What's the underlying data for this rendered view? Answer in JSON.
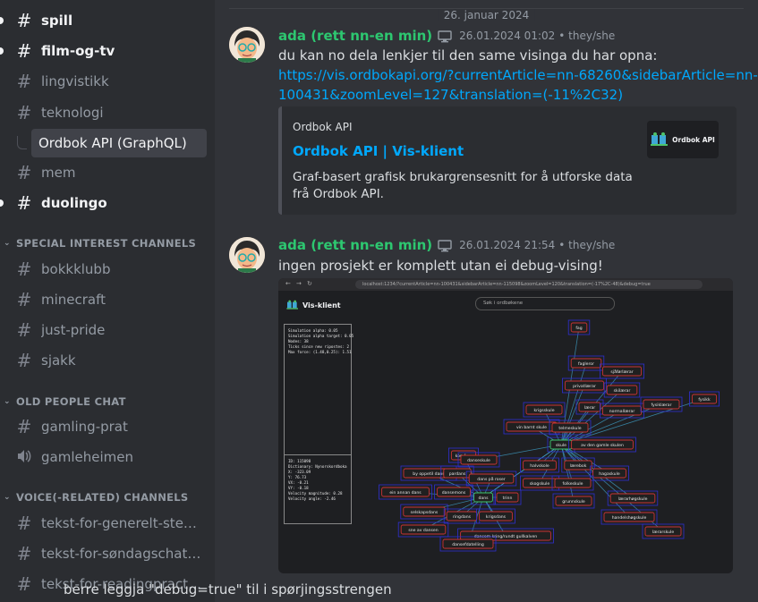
{
  "sidebar": {
    "channels_top": [
      {
        "name": "spill",
        "unread": true
      },
      {
        "name": "film-og-tv",
        "unread": true
      },
      {
        "name": "lingvistikk",
        "unread": false
      },
      {
        "name": "teknologi",
        "unread": false
      }
    ],
    "thread": "Ordbok API (GraphQL)",
    "channels_mid": [
      {
        "name": "mem",
        "unread": false
      },
      {
        "name": "duolingo",
        "unread": true
      }
    ],
    "cat_special": "SPECIAL INTEREST CHANNELS",
    "special": [
      "bokkklubb",
      "minecraft",
      "just-pride",
      "sjakk"
    ],
    "cat_old": "OLD PEOPLE CHAT",
    "old_text": "gamling-prat",
    "old_voice": "gamleheimen",
    "cat_voice": "VOICE(-RELATED) CHANNELS",
    "voice": [
      "tekst-for-generelt-stem...",
      "tekst-for-søndagschatten",
      "tekst-for-readingpractice"
    ]
  },
  "date_divider": "26. januar 2024",
  "messages": [
    {
      "user": "ada (rett nn-en min)",
      "timestamp": "26.01.2024 01:02",
      "pronouns": "• they/she",
      "text": "du kan no dela lenkjer til den same visinga du har opna:",
      "link_line1": "https://vis.ordbokapi.org/?currentArticle=nn-68260&sidebarArticle=nn-",
      "link_line2": "100431&zoomLevel=127&translation=(-11%2C32)",
      "embed": {
        "provider": "Ordbok API",
        "title": "Ordbok API | Vis-klient",
        "description": "Graf-basert grafisk brukargrensesnitt for å utforske data frå Ordbok API.",
        "thumb_label": "Ordbok API"
      }
    },
    {
      "user": "ada (rett nn-en min)",
      "timestamp": "26.01.2024 21:54",
      "pronouns": "• they/she",
      "text": "ingen prosjekt er komplett utan ei debug-vising!",
      "followup": "berre leggja \"debug=true\" til i spørjingsstrengen"
    }
  ],
  "screenshot": {
    "url": "localhost:1234/?currentArticle=nn-100431&sidebarArticle=nn-115098&zoomLevel=120&translation=(-17%2C-48)&debug=true",
    "app_title": "Vis-klient",
    "search_placeholder": "Søk i ordbøkene",
    "debug_lines": "Simulation alpha: 0.05\nSimulation alpha target: 0.05\nNodes: 38\nTicks since new ripostes: 2\nMax force: (1.48,0.25): 1.51",
    "debug_lines2": "ID: 115098\nDictionary: Nynorskordboka\nX: -323.09\nY: 76.73\nVX: -0.21\nVY: -0.18\nVelocity magnitude: 0.28\nVelocity angle: -2.46",
    "nodes": [
      {
        "label": "fag",
        "color": "red"
      },
      {
        "label": "fagleror",
        "color": "red"
      },
      {
        "label": "sjåførlærar",
        "color": "red"
      },
      {
        "label": "privatlærar",
        "color": "red"
      },
      {
        "label": "skilærar",
        "color": "red"
      },
      {
        "label": "lærar",
        "color": "red"
      },
      {
        "label": "normallærar",
        "color": "red"
      },
      {
        "label": "fysiklærar",
        "color": "red"
      },
      {
        "label": "fysikk",
        "color": "red"
      },
      {
        "label": "krigsskule",
        "color": "red"
      },
      {
        "label": "vin barnt skule",
        "color": "red"
      },
      {
        "label": "telmeskule",
        "color": "red"
      },
      {
        "label": "skule",
        "color": "green"
      },
      {
        "label": "av den gamle skulen",
        "color": "red"
      },
      {
        "label": "komfom",
        "color": "red"
      },
      {
        "label": "danseskule",
        "color": "red"
      },
      {
        "label": "halvskole",
        "color": "red"
      },
      {
        "label": "lærebok",
        "color": "red"
      },
      {
        "label": "hagaskule",
        "color": "red"
      },
      {
        "label": "by oppetil dans",
        "color": "red"
      },
      {
        "label": "pardans",
        "color": "red"
      },
      {
        "label": "dans på roser",
        "color": "red"
      },
      {
        "label": "skogskule",
        "color": "red"
      },
      {
        "label": "folkeskule",
        "color": "red"
      },
      {
        "label": "grunnskule",
        "color": "red"
      },
      {
        "label": "ein annan dans",
        "color": "red"
      },
      {
        "label": "dansemons",
        "color": "red"
      },
      {
        "label": "dans",
        "color": "green"
      },
      {
        "label": "trinn",
        "color": "red"
      },
      {
        "label": "lærarhøgskule",
        "color": "red"
      },
      {
        "label": "selskapsdans",
        "color": "red"
      },
      {
        "label": "ringdans",
        "color": "red"
      },
      {
        "label": "krigsdans",
        "color": "red"
      },
      {
        "label": "handelshøgskule",
        "color": "red"
      },
      {
        "label": "sne av dansen",
        "color": "red"
      },
      {
        "label": "dansem kring/rundt gullkalven",
        "color": "red"
      },
      {
        "label": "lærarskule",
        "color": "red"
      },
      {
        "label": "dansefdatelling",
        "color": "red"
      }
    ]
  }
}
